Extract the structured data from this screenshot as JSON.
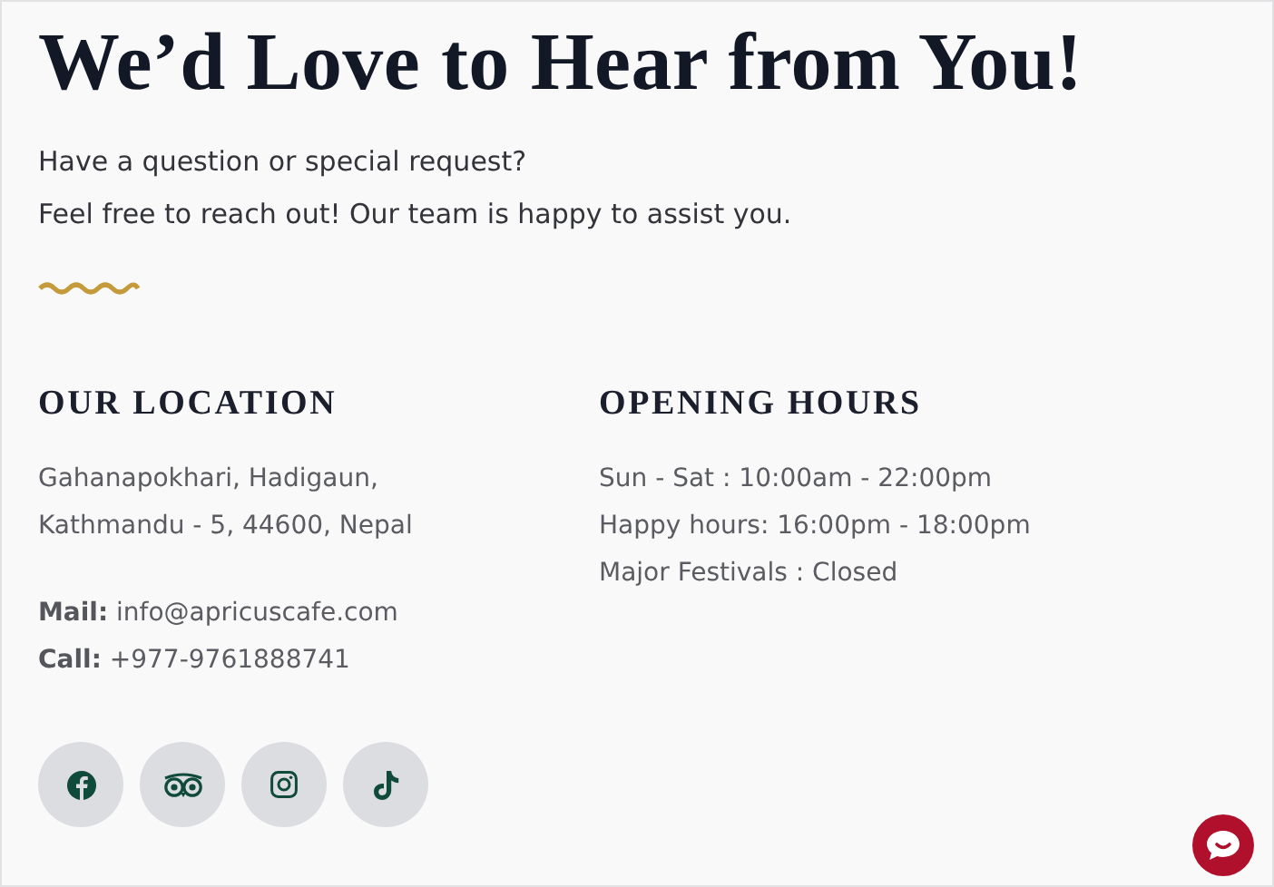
{
  "title": "We’d Love to Hear from You!",
  "intro": [
    "Have a question or special request?",
    "Feel free to reach out! Our team is happy to assist you."
  ],
  "location": {
    "heading": "OUR LOCATION",
    "address": [
      "Gahanapokhari, Hadigaun,",
      "Kathmandu - 5, 44600, Nepal"
    ],
    "contacts": [
      {
        "label": "Mail:",
        "value": "info@apricuscafe.com"
      },
      {
        "label": "Call:",
        "value": "+977-9761888741"
      }
    ]
  },
  "hours": {
    "heading": "OPENING HOURS",
    "lines": [
      "Sun - Sat : 10:00am - 22:00pm",
      "Happy hours: 16:00pm - 18:00pm",
      "Major Festivals : Closed"
    ]
  },
  "social": [
    {
      "kind": "f"
    },
    {
      "kind": "owl"
    },
    {
      "kind": "camera"
    },
    {
      "kind": "note"
    }
  ]
}
